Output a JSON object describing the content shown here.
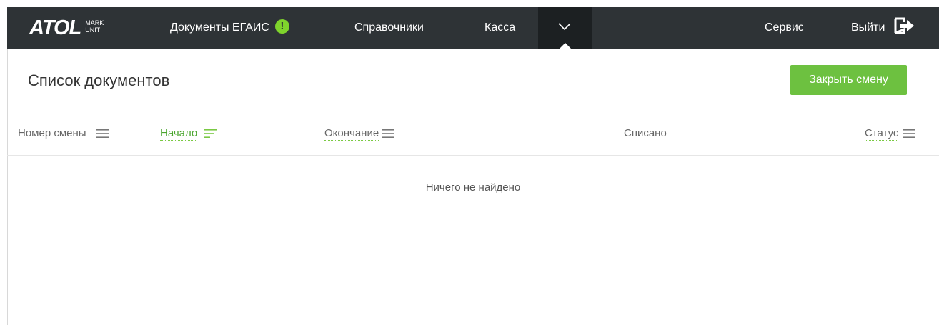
{
  "navbar": {
    "logo": {
      "main": "ATOL",
      "sub_line1": "MARK",
      "sub_line2": "UNIT"
    },
    "items": [
      {
        "label": "Документы ЕГАИС",
        "badge": "!"
      },
      {
        "label": "Справочники"
      },
      {
        "label": "Касса"
      }
    ],
    "more_icon": "chevron-down-icon",
    "service_label": "Сервис",
    "exit_label": "Выйти",
    "exit_icon": "logout-icon",
    "colors": {
      "bar": "#2e3336",
      "badge": "#7fd42c"
    }
  },
  "page": {
    "title": "Список документов",
    "close_shift_label": "Закрыть смену",
    "accent": "#6dc140"
  },
  "table": {
    "columns": [
      {
        "label": "Номер смены",
        "icon": "menu-icon"
      },
      {
        "label": "Начало",
        "icon": "sort-icon",
        "active": true
      },
      {
        "label": "Окончание",
        "icon": "menu-icon"
      },
      {
        "label": "Списано"
      },
      {
        "label": "Статус",
        "icon": "menu-icon"
      }
    ],
    "empty_message": "Ничего не найдено"
  }
}
